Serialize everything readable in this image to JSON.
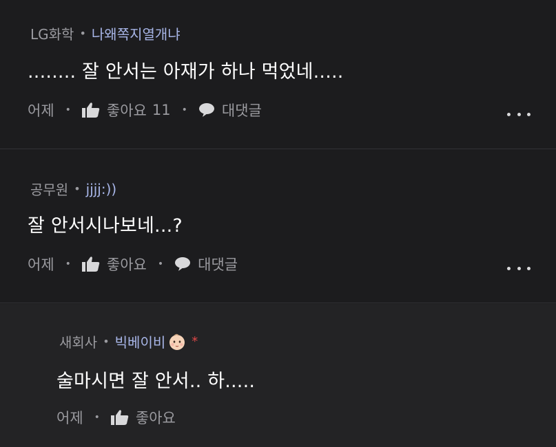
{
  "comments": [
    {
      "company": "LG화학",
      "separator": "•",
      "nickname": "나왜쪽지열개냐",
      "text": "........ 잘 안서는 아재가 하나 먹었네.....",
      "time": "어제",
      "like_label": "좋아요",
      "like_count": "11",
      "reply_label": "대댓글"
    },
    {
      "company": "공무원",
      "separator": "•",
      "nickname": "jjjj:))",
      "text": "잘 안서시나보네...?",
      "time": "어제",
      "like_label": "좋아요",
      "reply_label": "대댓글"
    },
    {
      "company": "새회사",
      "separator": "•",
      "nickname": "빅베이비",
      "badge": "*",
      "text": "술마시면 잘 안서.. 하.....",
      "time": "어제",
      "like_label": "좋아요"
    }
  ],
  "dot": "•",
  "icons": {
    "like": "thumbs-up-icon",
    "reply": "speech-bubble-icon",
    "more": "more-dots-icon",
    "avatar_emoji": "baby-face-emoji"
  },
  "colors": {
    "background": "#1c1c1e",
    "reply_background": "#232325",
    "nickname": "#a8b6e8",
    "muted": "#9b9ba0",
    "badge": "#e04848"
  }
}
